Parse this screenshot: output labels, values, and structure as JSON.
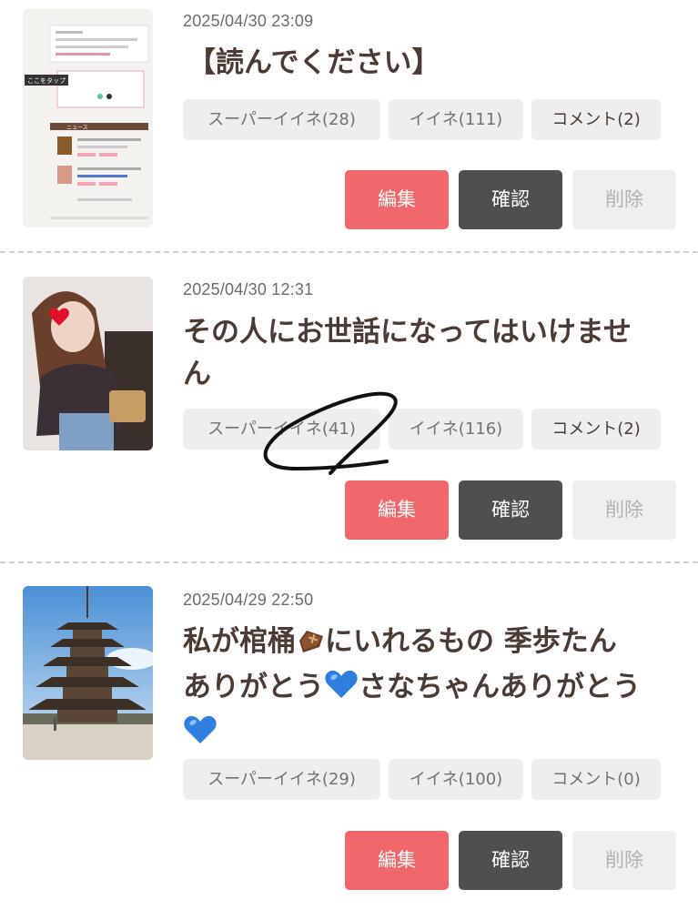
{
  "posts": [
    {
      "timestamp": "2025/04/30 23:09",
      "title": "【読んでください】",
      "chips": {
        "super_like": "スーパーイイネ(28)",
        "like": "イイネ(111)",
        "comment": "コメント(2)"
      },
      "thumb": {
        "overlay_label": "ここをタップ",
        "section_label": "ニュース"
      }
    },
    {
      "timestamp": "2025/04/30 12:31",
      "title_line1": "その人にお世話になってはいけませ",
      "title_line2": "ん",
      "chips": {
        "super_like": "スーパーイイネ(41)",
        "like": "イイネ(116)",
        "comment": "コメント(2)"
      }
    },
    {
      "timestamp": "2025/04/29 22:50",
      "title_line1_a": "私が棺桶",
      "title_line1_b": "にいれるもの 季歩たん",
      "title_line2_a": "ありがとう",
      "title_line2_b": "さなちゃんありがとう",
      "chips": {
        "super_like": "スーパーイイネ(29)",
        "like": "イイネ(100)",
        "comment": "コメント(0)"
      }
    }
  ],
  "buttons": {
    "edit": "編集",
    "check": "確認",
    "delete": "削除"
  },
  "icons": {
    "coffin": "coffin-emoji",
    "heart": "blue-heart-emoji"
  },
  "colors": {
    "edit": "#f0676b",
    "check": "#4f4f4f",
    "delete_bg": "#efefef",
    "text": "#4a3b34",
    "chip_bg": "#eeeeee",
    "heart_blue": "#2f7fe0"
  }
}
